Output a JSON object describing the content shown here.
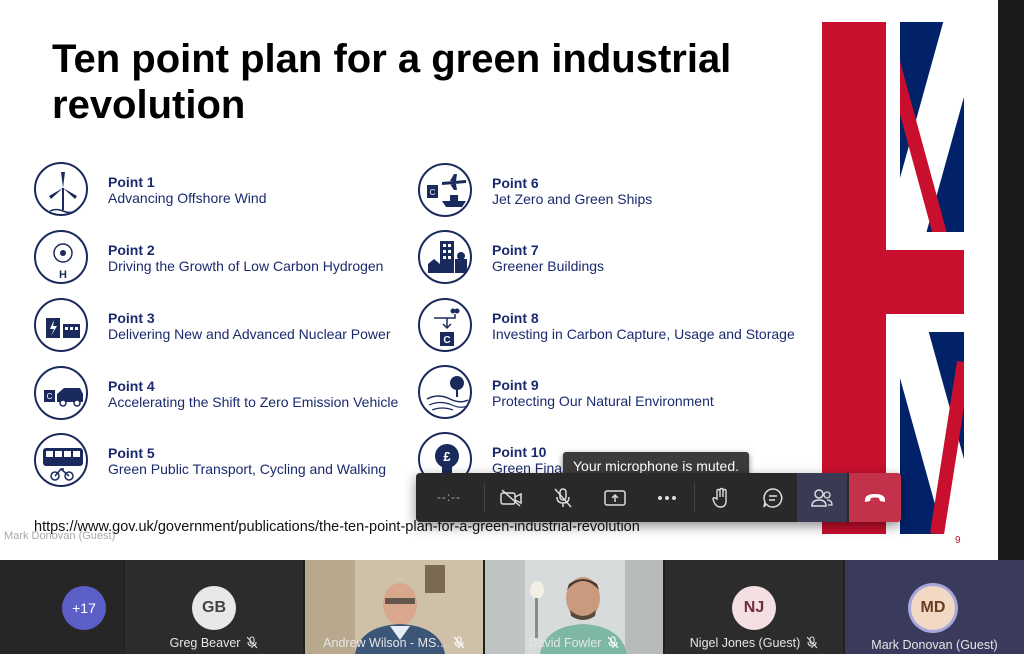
{
  "slide": {
    "title": "Ten point plan for a green industrial revolution",
    "url": "https://www.gov.uk/government/publications/the-ten-point-plan-for-a-green-industrial-revolution",
    "number": "9",
    "presenter_label": "Mark Donovan (Guest)",
    "points": [
      {
        "title": "Point 1",
        "desc": "Advancing Offshore Wind",
        "icon": "wind-turbine-icon"
      },
      {
        "title": "Point 2",
        "desc": "Driving the Growth of Low Carbon Hydrogen",
        "icon": "hydrogen-icon"
      },
      {
        "title": "Point 3",
        "desc": "Delivering New and Advanced Nuclear Power",
        "icon": "nuclear-power-icon"
      },
      {
        "title": "Point 4",
        "desc": "Accelerating the Shift to Zero Emission Vehicle",
        "icon": "electric-car-icon"
      },
      {
        "title": "Point 5",
        "desc": "Green Public Transport, Cycling and Walking",
        "icon": "bus-bike-icon"
      },
      {
        "title": "Point 6",
        "desc": "Jet Zero and Green Ships",
        "icon": "plane-ship-icon"
      },
      {
        "title": "Point 7",
        "desc": "Greener Buildings",
        "icon": "buildings-icon"
      },
      {
        "title": "Point 8",
        "desc": "Investing in Carbon Capture, Usage and Storage",
        "icon": "carbon-capture-icon"
      },
      {
        "title": "Point 9",
        "desc": "Protecting Our Natural Environment",
        "icon": "nature-icon"
      },
      {
        "title": "Point 10",
        "desc": "Green Finance and Innovation",
        "icon": "finance-lightbulb-icon"
      }
    ]
  },
  "tooltip": "Your microphone is muted.",
  "call_bar": {
    "timer": "--:--",
    "buttons": [
      "camera-off",
      "mic-muted",
      "share-screen",
      "more-actions",
      "raise-hand",
      "chat",
      "participants",
      "hang-up"
    ]
  },
  "participants": {
    "overflow_count": "+17",
    "tiles": [
      {
        "name": "Greg Beaver",
        "initials": "GB",
        "muted": true
      },
      {
        "name": "Andrew Wilson - MS...",
        "initials": "",
        "muted": true
      },
      {
        "name": "David Fowler",
        "initials": "",
        "muted": true
      },
      {
        "name": "Nigel Jones (Guest)",
        "initials": "NJ",
        "muted": true
      },
      {
        "name": "Mark Donovan (Guest)",
        "initials": "MD",
        "muted": false
      }
    ]
  },
  "colors": {
    "slide_text": "#1b2a6e",
    "flag_red": "#c8102e",
    "flag_blue": "#012169",
    "hangup": "#c4314b",
    "avatar_accent": "#5b5fc7"
  }
}
